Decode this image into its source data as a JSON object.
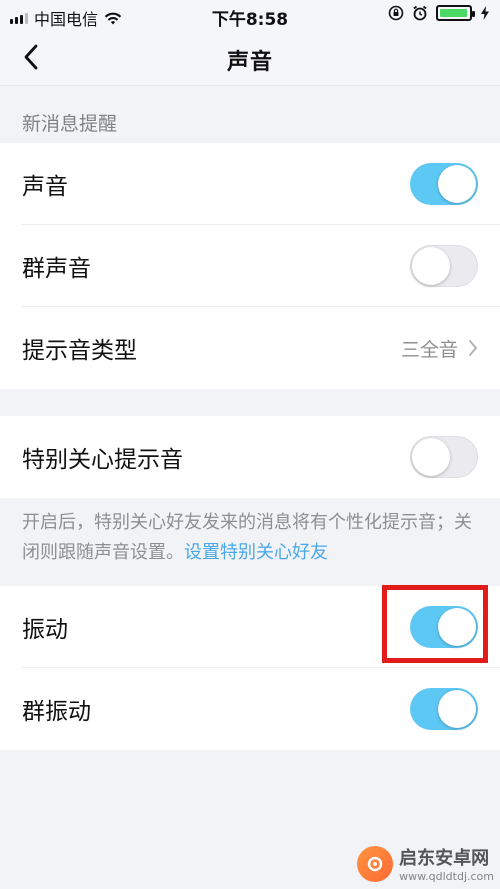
{
  "status_bar": {
    "carrier": "中国电信",
    "time": "下午8:58",
    "battery_level": 0.95,
    "battery_color": "#4cd964"
  },
  "nav": {
    "back_icon": "chevron-left-icon",
    "title": "声音"
  },
  "sections": {
    "new_message_title": "新消息提醒"
  },
  "group1": {
    "sound_label": "声音",
    "sound_on": true,
    "group_sound_label": "群声音",
    "group_sound_on": false,
    "tone_type_label": "提示音类型",
    "tone_type_value": "三全音"
  },
  "group2": {
    "special_care_label": "特别关心提示音",
    "special_care_on": false,
    "description": "开启后，特别关心好友发来的消息将有个性化提示音；关闭则跟随声音设置。",
    "description_link": "设置特别关心好友"
  },
  "group3": {
    "vibrate_label": "振动",
    "vibrate_on": true,
    "group_vibrate_label": "群振动",
    "group_vibrate_on": true
  },
  "colors": {
    "toggle_on": "#5ec8f5",
    "toggle_off": "#eaeaef",
    "highlight": "#e21b1b",
    "link": "#4aa8e8"
  },
  "watermark": {
    "name": "启东安卓网",
    "url": "www.qdldtdj.com"
  }
}
